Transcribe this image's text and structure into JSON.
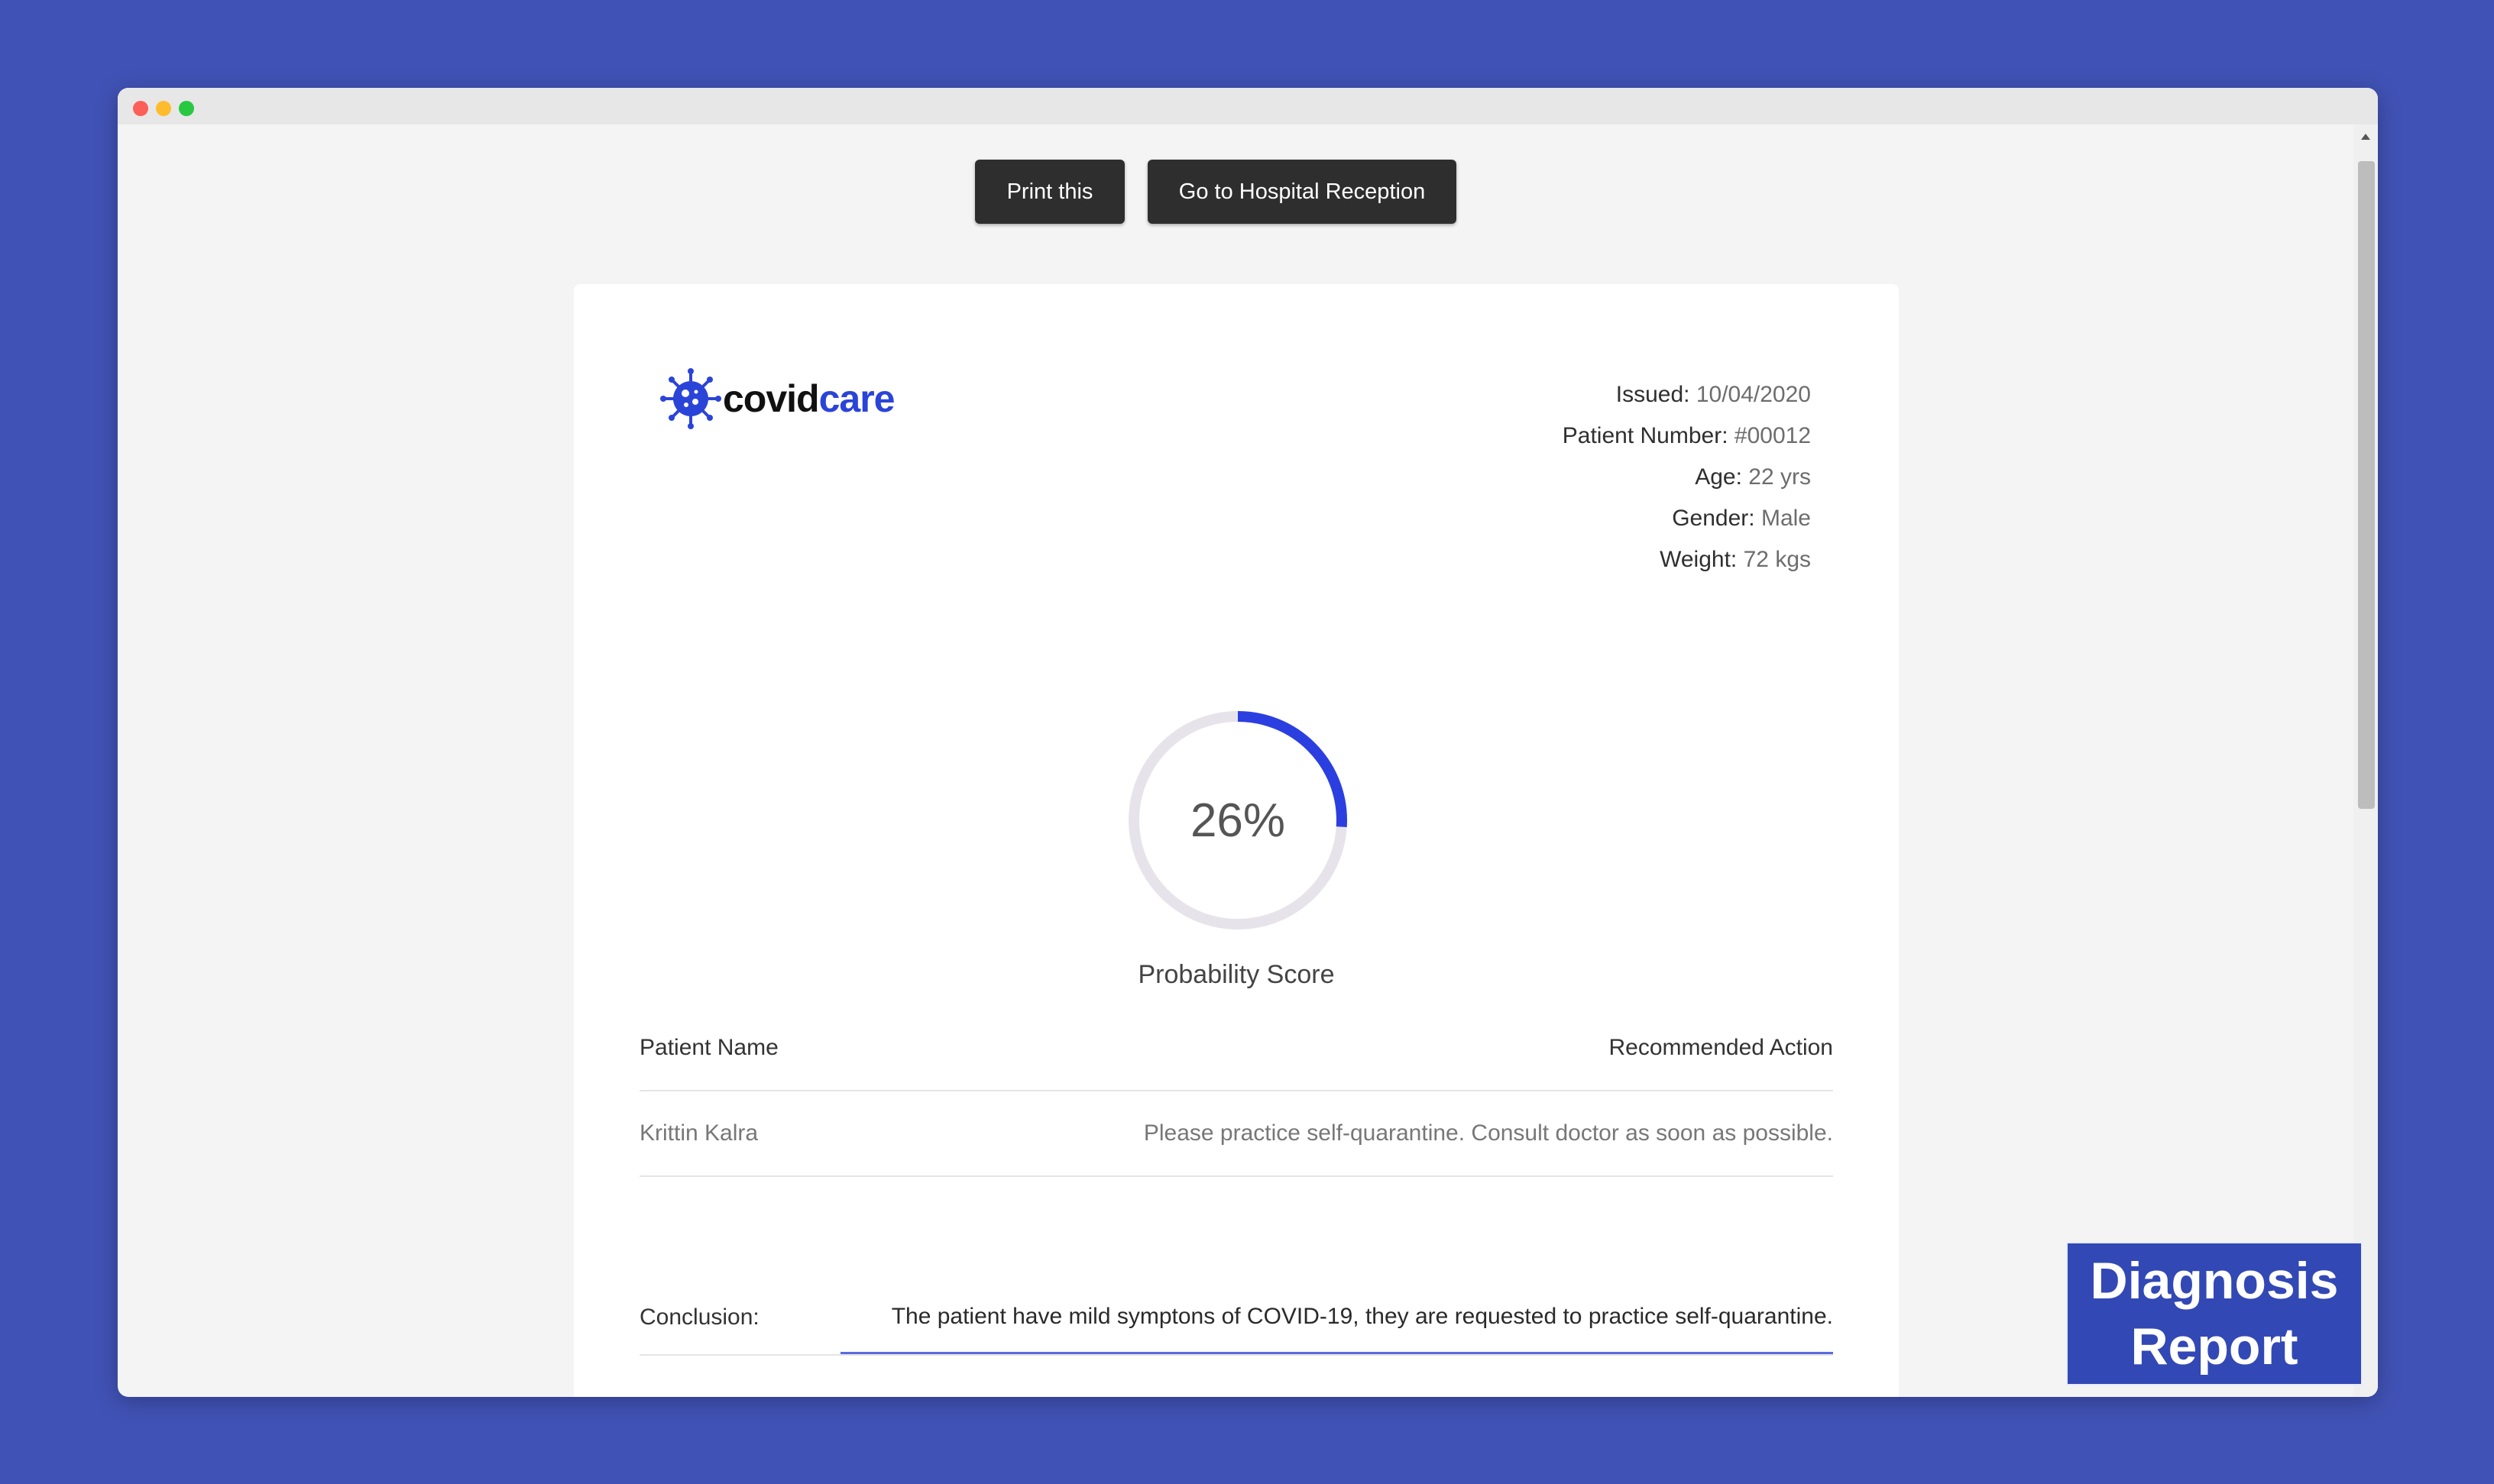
{
  "toolbar": {
    "print_label": "Print this",
    "reception_label": "Go to Hospital Reception"
  },
  "brand": {
    "name_dark": "covid",
    "name_blue": "care",
    "accent_color": "#2b44d8"
  },
  "meta": {
    "issued_label": "Issued:",
    "issued_value": "10/04/2020",
    "patient_number_label": "Patient Number:",
    "patient_number_value": "#00012",
    "age_label": "Age:",
    "age_value": "22 yrs",
    "gender_label": "Gender:",
    "gender_value": "Male",
    "weight_label": "Weight:",
    "weight_value": "72 kgs"
  },
  "score": {
    "value": 26,
    "display": "26%",
    "label": "Probability Score",
    "progress_color": "#2b3fe0",
    "track_color": "#e6e4ea"
  },
  "table": {
    "headers": [
      "Patient Name",
      "Recommended Action"
    ],
    "rows": [
      [
        "Krittin Kalra",
        "Please practice self-quarantine. Consult doctor as soon as possible."
      ]
    ]
  },
  "conclusion": {
    "label": "Conclusion:",
    "text": "The patient have mild symptons of COVID-19, they are requested to practice self-quarantine."
  },
  "badge": {
    "line1": "Diagnosis",
    "line2": "Report"
  },
  "icons": {
    "logo": "virus-icon"
  }
}
